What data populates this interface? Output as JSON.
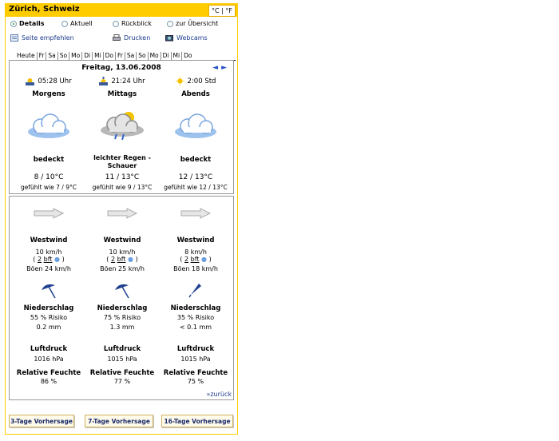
{
  "header": {
    "title": "Zürich, Schweiz",
    "unit_c": "°C",
    "unit_sep": "|",
    "unit_f": "°F"
  },
  "modes": [
    {
      "label": "Details",
      "selected": true
    },
    {
      "label": "Aktuell",
      "selected": false
    },
    {
      "label": "Rückblick",
      "selected": false
    },
    {
      "label": "zur Übersicht",
      "selected": false
    }
  ],
  "links": {
    "recommend": "Seite empfehlen",
    "print": "Drucken",
    "webcams": "Webcams"
  },
  "day_tabs": [
    "Heute",
    "Fr",
    "Sa",
    "So",
    "Mo",
    "Di",
    "Mi",
    "Do",
    "Fr",
    "Sa",
    "So",
    "Mo",
    "Di",
    "Mi",
    "Do"
  ],
  "date": "Freitag, 13.06.2008",
  "nav": {
    "prev": "◄",
    "next": "►"
  },
  "periods": [
    {
      "time": "05:28 Uhr",
      "time_icon": "sunrise-icon",
      "label": "Morgens",
      "weather_icon": "cloud-icon",
      "condition": "bedeckt",
      "temp": "8 / 10°C",
      "feels": "gefühlt wie 7 / 9°C",
      "wind_dir": "Westwind",
      "wind_speed": "10 km/h",
      "bft": "2",
      "bft_unit": "bft",
      "gusts": "Böen 24 km/h",
      "precip_label": "Niederschlag",
      "precip_risk": "55 % Risiko",
      "precip_amount": "0.2 mm",
      "pressure_label": "Luftdruck",
      "pressure": "1016 hPa",
      "humidity_label": "Relative Feuchte",
      "humidity": "86 %"
    },
    {
      "time": "21:24 Uhr",
      "time_icon": "sunset-icon",
      "label": "Mittags",
      "weather_icon": "rain-shower-icon",
      "condition": "leichter Regen - Schauer",
      "temp": "11 / 13°C",
      "feels": "gefühlt wie 9 / 13°C",
      "wind_dir": "Westwind",
      "wind_speed": "10 km/h",
      "bft": "2",
      "bft_unit": "bft",
      "gusts": "Böen 25 km/h",
      "precip_label": "Niederschlag",
      "precip_risk": "75 % Risiko",
      "precip_amount": "1.3 mm",
      "pressure_label": "Luftdruck",
      "pressure": "1015 hPa",
      "humidity_label": "Relative Feuchte",
      "humidity": "77 %"
    },
    {
      "time": "2:00 Std",
      "time_icon": "sun-icon",
      "label": "Abends",
      "weather_icon": "cloud-icon",
      "condition": "bedeckt",
      "temp": "12 / 13°C",
      "feels": "gefühlt wie 12 / 13°C",
      "wind_dir": "Westwind",
      "wind_speed": "8 km/h",
      "bft": "2",
      "bft_unit": "bft",
      "gusts": "Böen 18 km/h",
      "precip_label": "Niederschlag",
      "precip_risk": "35 % Risiko",
      "precip_amount": "< 0.1 mm",
      "pressure_label": "Luftdruck",
      "pressure": "1015 hPa",
      "humidity_label": "Relative Feuchte",
      "humidity": "75 %"
    }
  ],
  "back_link": "»zurück",
  "buttons": [
    "3-Tage Vorhersage",
    "7-Tage Vorhersage",
    "16-Tage Vorhersage"
  ],
  "colors": {
    "accent": "#ffcc00",
    "link": "#1a3a8a"
  }
}
